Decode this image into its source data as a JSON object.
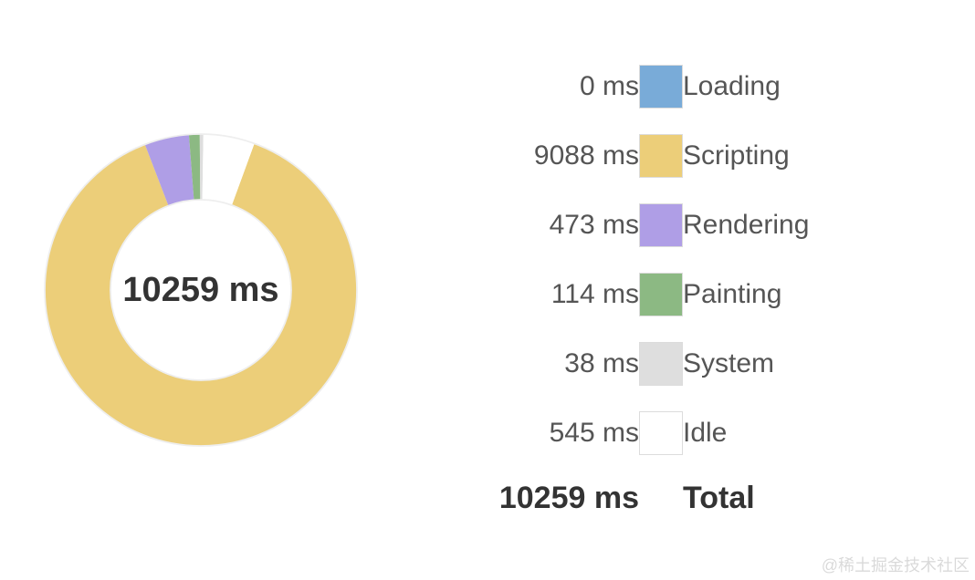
{
  "chart_data": {
    "type": "pie",
    "title": "",
    "donut": true,
    "center_label": "10259 ms",
    "unit": "ms",
    "series": [
      {
        "name": "Loading",
        "value": 0,
        "color": "#79abd8"
      },
      {
        "name": "Scripting",
        "value": 9088,
        "color": "#ecce79"
      },
      {
        "name": "Rendering",
        "value": 473,
        "color": "#af9ee6"
      },
      {
        "name": "Painting",
        "value": 114,
        "color": "#8cb983"
      },
      {
        "name": "System",
        "value": 38,
        "color": "#dedede"
      },
      {
        "name": "Idle",
        "value": 545,
        "color": "#ffffff"
      }
    ],
    "total": {
      "label": "Total",
      "value": 10259
    }
  },
  "watermark": "@稀土掘金技术社区"
}
